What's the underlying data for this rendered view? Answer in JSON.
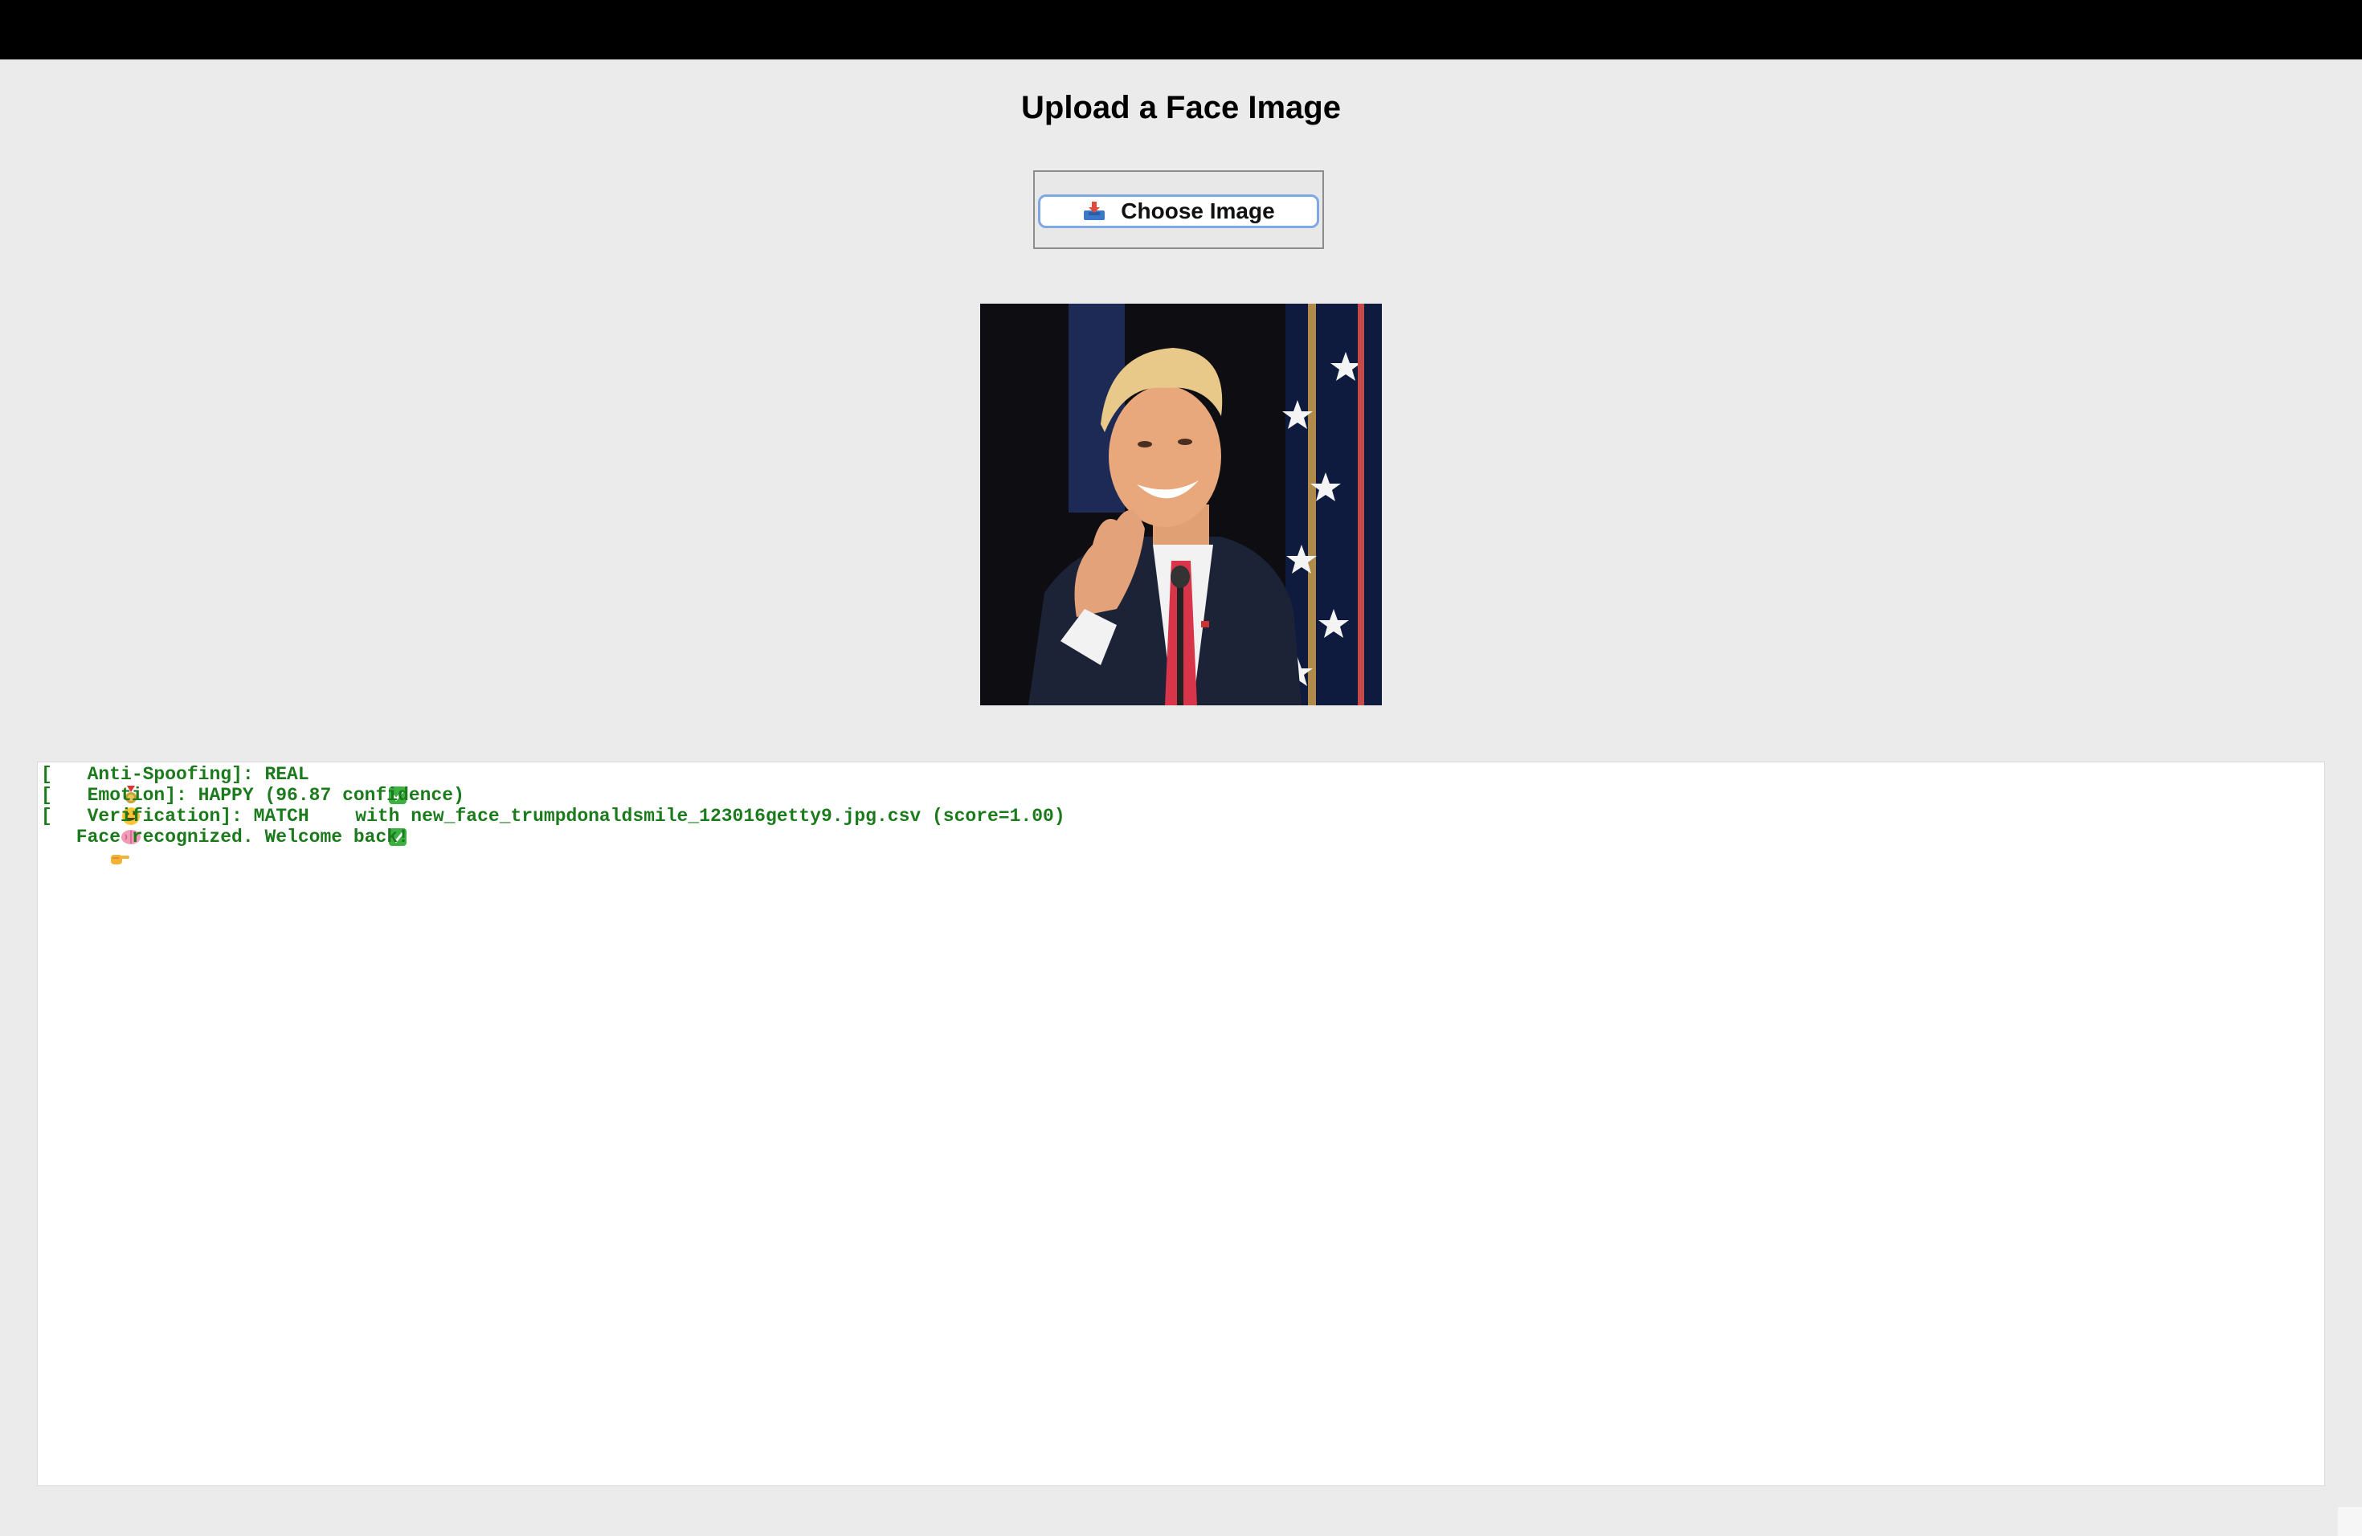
{
  "page": {
    "title": "Upload a Face Image"
  },
  "upload": {
    "button_label": "Choose Image",
    "icon": "inbox-tray-icon"
  },
  "preview": {
    "image": "uploaded-face-photo"
  },
  "log": {
    "lines": [
      {
        "icon": "medal-icon",
        "prefix": "[",
        "text": " Anti-Spoofing]: REAL ",
        "suffix_icon": "check-mark-icon"
      },
      {
        "icon": "smiley-icon",
        "prefix": "[",
        "text": " Emotion]: HAPPY (96.87 confidence)",
        "suffix_icon": ""
      },
      {
        "icon": "brain-icon",
        "prefix": "[",
        "text": " Verification]: MATCH ",
        "suffix_icon": "check-mark-icon",
        "tail": " with new_face_trumpdonaldsmile_123016getty9.jpg.csv (score=1.00)"
      },
      {
        "icon": "pointing-hand-icon",
        "prefix": "",
        "text": " Face recognized. Welcome back!",
        "suffix_icon": ""
      }
    ]
  },
  "colors": {
    "log_text": "#1b7a1b",
    "button_border": "#7fa7e6",
    "background": "#ebebeb",
    "top_bar": "#000000"
  }
}
